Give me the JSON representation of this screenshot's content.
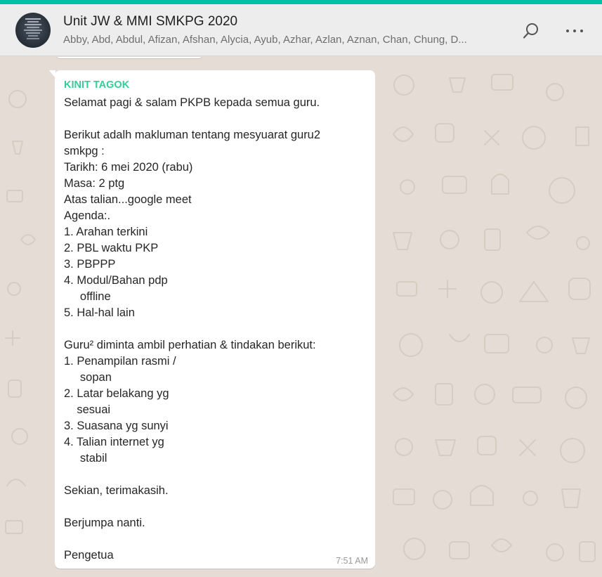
{
  "colors": {
    "accent": "#00bfa5",
    "sender": "#35cd96",
    "chat_bg": "#e5ddd5",
    "header_bg": "#ededed",
    "bubble_bg": "#ffffff"
  },
  "header": {
    "avatar_icon": "group-avatar-icon",
    "title": "Unit JW & MMI SMKPG 2020",
    "participants": "Abby, Abd, Abdul, Afizan, Afshan, Alycia, Ayub, Azhar, Azlan, Aznan, Chan, Chung, D...",
    "search_icon": "search-icon",
    "menu_icon": "more-options-icon"
  },
  "message": {
    "sender": "KINIT TAGOK",
    "lines": [
      "Selamat pagi & salam PKPB kepada semua guru.",
      "",
      "Berikut adalh makluman tentang mesyuarat guru2",
      "smkpg :",
      "Tarikh: 6 mei 2020 (rabu)",
      "Masa: 2 ptg",
      "Atas talian...google meet",
      "Agenda:.",
      "1. Arahan terkini",
      "2. PBL waktu PKP",
      "3. PBPPP",
      "4. Modul/Bahan pdp",
      "     offline",
      "5. Hal-hal lain",
      "",
      "Guru² diminta ambil perhatian & tindakan berikut:",
      "1. Penampilan rasmi /",
      "     sopan",
      "2. Latar belakang yg",
      "    sesuai",
      "3. Suasana yg sunyi",
      "4. Talian internet yg",
      "     stabil",
      "",
      "Sekian, terimakasih.",
      "",
      "Berjumpa nanti.",
      "",
      "Pengetua"
    ],
    "time": "7:51 AM"
  }
}
